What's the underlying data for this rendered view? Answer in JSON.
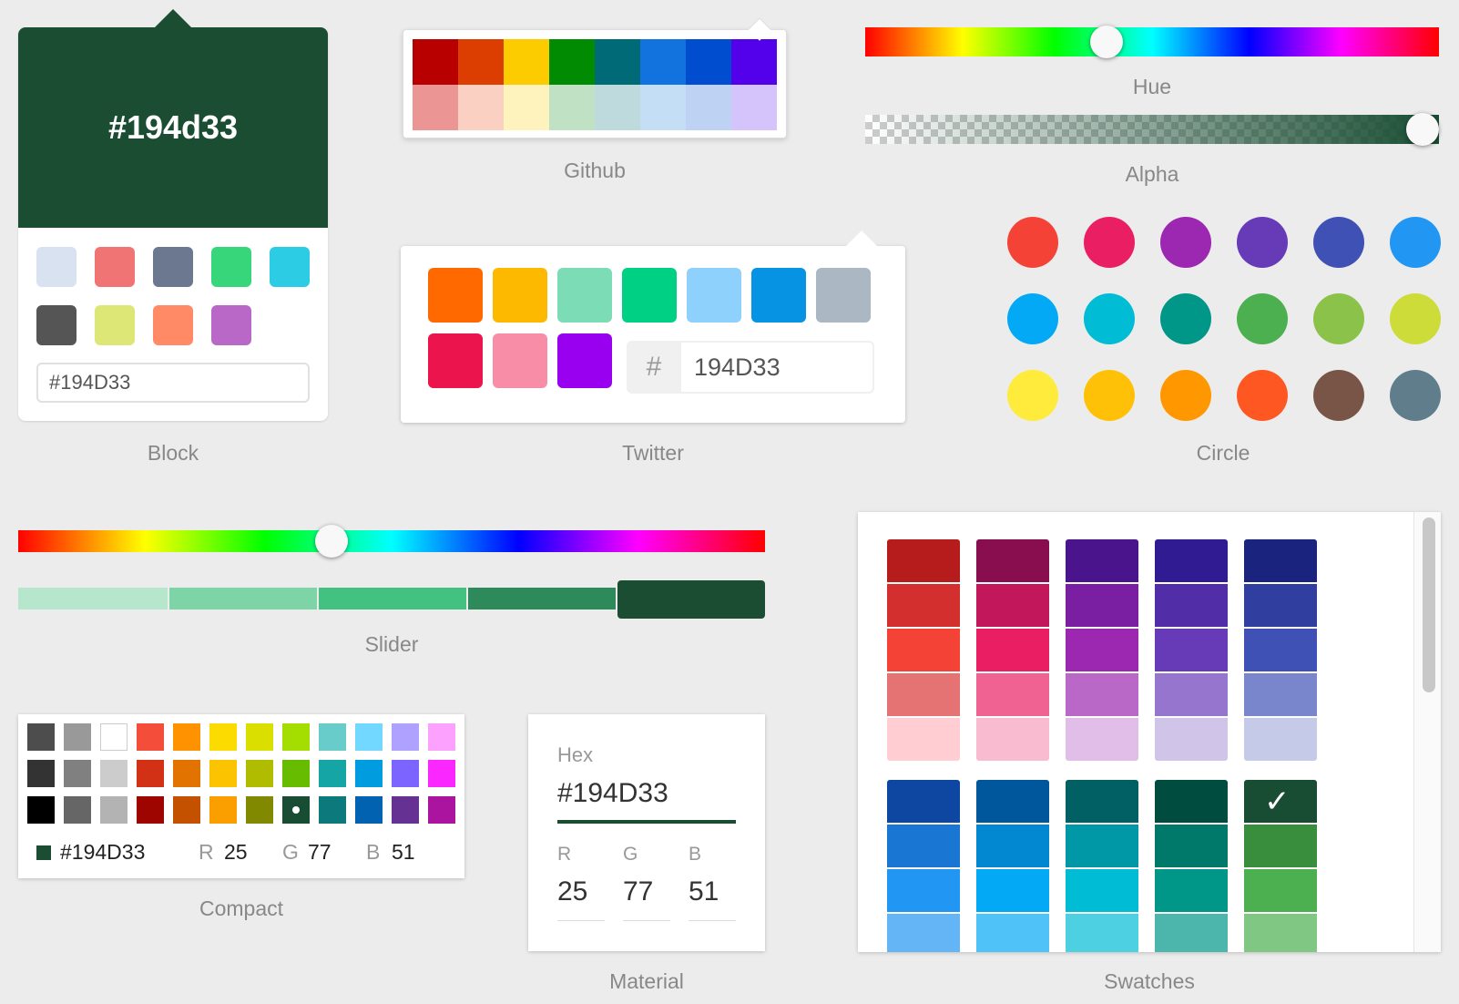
{
  "current": {
    "hex_lower": "#194d33",
    "hex_upper": "#194D33",
    "hex_plain": "194D33",
    "r": "25",
    "g": "77",
    "b": "51",
    "color": "#1b4d33"
  },
  "block": {
    "caption": "Block",
    "input_value": "#194D33",
    "swatches": [
      "#d8e2f0",
      "#f07474",
      "#6b7890",
      "#38d67a",
      "#2ccce4",
      "#555555",
      "#dce775",
      "#ff8a65",
      "#ba68c8"
    ]
  },
  "github": {
    "caption": "Github",
    "colors": [
      "#b80000",
      "#db3e00",
      "#fccb00",
      "#008b02",
      "#006b76",
      "#1273de",
      "#004dcf",
      "#5300eb",
      "#eb9694",
      "#fad0c3",
      "#fef3bd",
      "#c1e1c5",
      "#bedadc",
      "#c4def6",
      "#bed3f3",
      "#d4c4fb"
    ]
  },
  "twitter": {
    "caption": "Twitter",
    "colors": [
      "#ff6900",
      "#fcb900",
      "#7bdcb5",
      "#00d084",
      "#8ed1fc",
      "#0693e3",
      "#abb8c3",
      "#eb144c",
      "#f78da7",
      "#9900ef"
    ],
    "hash": "#",
    "hex_value": "194D33"
  },
  "hue": {
    "caption": "Hue",
    "value_fraction": 0.42
  },
  "alpha": {
    "caption": "Alpha",
    "value_fraction": 1.0
  },
  "circle": {
    "caption": "Circle",
    "colors": [
      "#f44336",
      "#e91e63",
      "#9c27b0",
      "#673ab7",
      "#3f51b5",
      "#2196f3",
      "#03a9f4",
      "#00bcd4",
      "#009688",
      "#4caf50",
      "#8bc34a",
      "#cddc39",
      "#ffeb3b",
      "#ffc107",
      "#ff9800",
      "#ff5722",
      "#795548",
      "#607d8b"
    ]
  },
  "slider": {
    "caption": "Slider",
    "hue_fraction": 0.42,
    "steps": [
      "#b6e6cc",
      "#7dd4a6",
      "#43c181",
      "#2e8a5b",
      "#1b4d33"
    ],
    "active_step": 4
  },
  "compact": {
    "caption": "Compact",
    "colors": [
      "#4d4d4d",
      "#999999",
      "#ffffff",
      "#f44e3b",
      "#fe9200",
      "#fcdc00",
      "#dbdf00",
      "#a4dd00",
      "#68ccca",
      "#73d8ff",
      "#aea1ff",
      "#fda1ff",
      "#333333",
      "#808080",
      "#cccccc",
      "#d33115",
      "#e27300",
      "#fcc400",
      "#b0bc00",
      "#68bc00",
      "#16a5a5",
      "#009ce0",
      "#7b64ff",
      "#fa28ff",
      "#000000",
      "#666666",
      "#b3b3b3",
      "#9f0500",
      "#c45100",
      "#fb9e00",
      "#808900",
      "#194d33",
      "#0c797d",
      "#0062b1",
      "#653294",
      "#ab149e"
    ],
    "selected_index": 31,
    "r_label": "R",
    "g_label": "G",
    "b_label": "B"
  },
  "material": {
    "caption": "Material",
    "hex_label": "Hex",
    "r_label": "R",
    "g_label": "G",
    "b_label": "B"
  },
  "swatches": {
    "caption": "Swatches",
    "groups_row1": [
      [
        "#b71c1c",
        "#d32f2f",
        "#f44336",
        "#e57373",
        "#ffcdd2"
      ],
      [
        "#880e4f",
        "#c2185b",
        "#e91e63",
        "#f06292",
        "#f8bbd0"
      ],
      [
        "#4a148c",
        "#7b1fa2",
        "#9c27b0",
        "#ba68c8",
        "#e1bee7"
      ],
      [
        "#311b92",
        "#512da8",
        "#673ab7",
        "#9575cd",
        "#d1c4e9"
      ],
      [
        "#1a237e",
        "#303f9f",
        "#3f51b5",
        "#7986cb",
        "#c5cae9"
      ]
    ],
    "groups_row2": [
      [
        "#0d47a1",
        "#1976d2",
        "#2196f3",
        "#64b5f6"
      ],
      [
        "#01579b",
        "#0288d1",
        "#03a9f4",
        "#4fc3f7"
      ],
      [
        "#006064",
        "#0097a7",
        "#00bcd4",
        "#4dd0e1"
      ],
      [
        "#004d40",
        "#00796b",
        "#009688",
        "#4db6ac"
      ],
      [
        "#194d33",
        "#388e3c",
        "#4caf50",
        "#81c784"
      ]
    ],
    "check": "✓"
  }
}
